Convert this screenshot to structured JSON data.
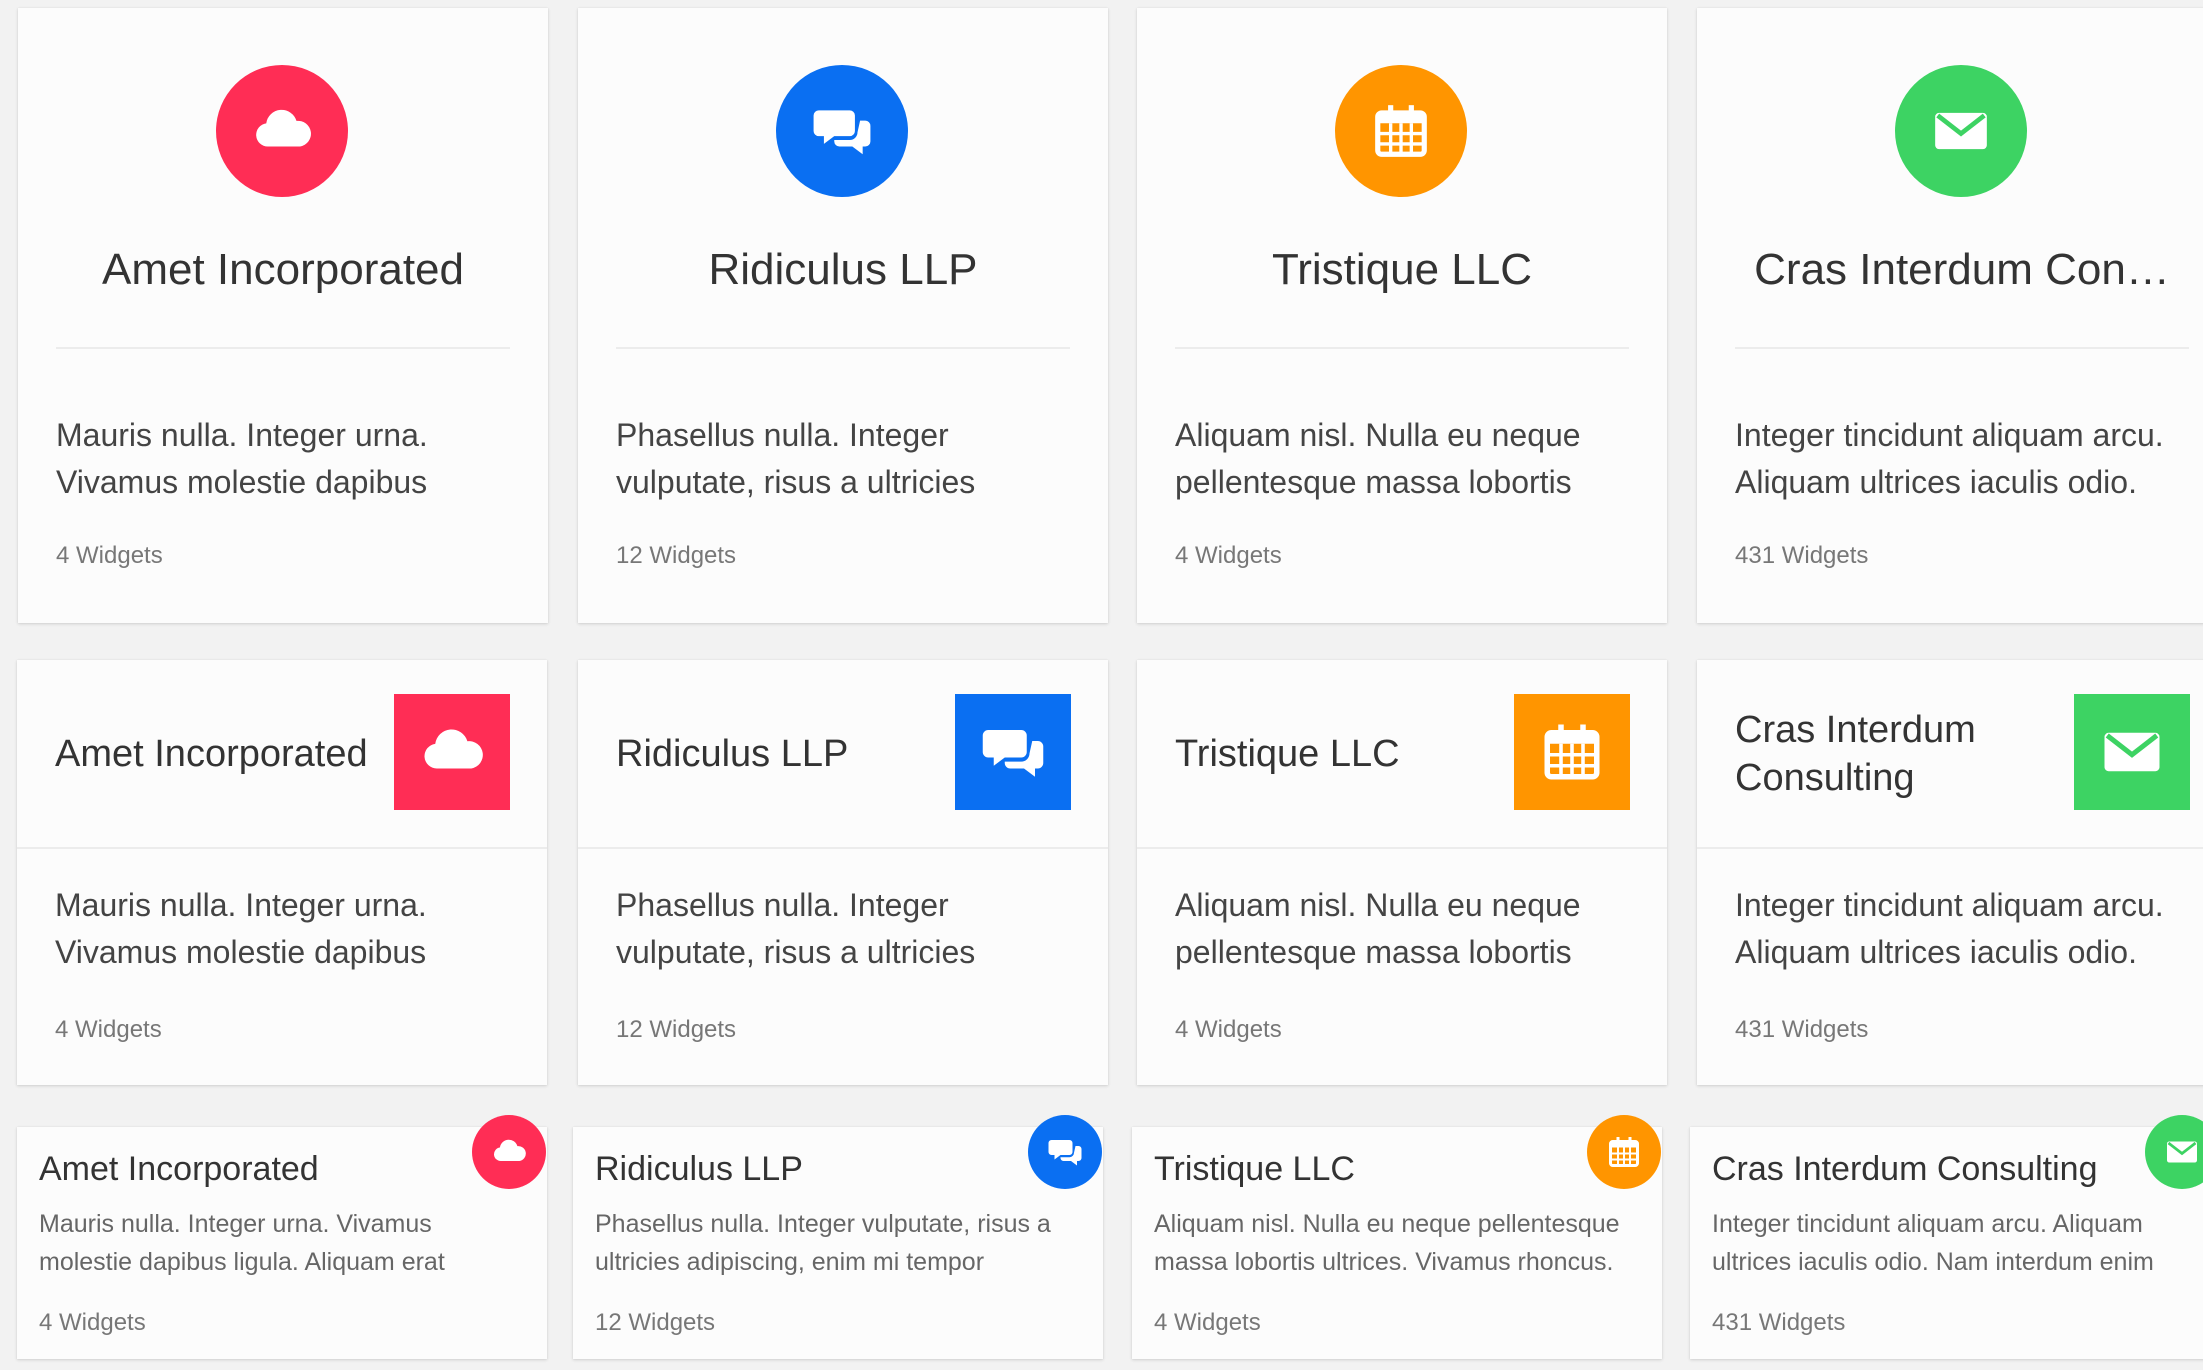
{
  "colors": {
    "red": "#ff2d55",
    "blue": "#0a6ff2",
    "orange": "#ff9500",
    "green": "#3dd363"
  },
  "companies": [
    {
      "name": "Amet Incorporated",
      "name_truncated": "Amet Incorporated",
      "name_wrapped": "Amet Incorporated",
      "icon": "cloud-icon",
      "desc_full": "Mauris nulla. Integer urna. Vivamus molestie dapibus",
      "desc_compact": "Mauris nulla. Integer urna. Vivamus molestie dapibus ligula. Aliquam erat",
      "widgets": "4 Widgets"
    },
    {
      "name": "Ridiculus LLP",
      "name_truncated": "Ridiculus LLP",
      "name_wrapped": "Ridiculus LLP",
      "icon": "chat-bubbles-icon",
      "desc_full": "Phasellus nulla. Integer vulputate, risus a ultricies",
      "desc_compact": "Phasellus nulla. Integer vulputate, risus a ultricies adipiscing, enim mi tempor",
      "widgets": "12 Widgets"
    },
    {
      "name": "Tristique LLC",
      "name_truncated": "Tristique LLC",
      "name_wrapped": "Tristique LLC",
      "icon": "calendar-icon",
      "desc_full": "Aliquam nisl. Nulla eu neque pellentesque massa lobortis",
      "desc_compact": "Aliquam nisl. Nulla eu neque pellentesque massa lobortis ultrices. Vivamus rhoncus.",
      "widgets": "4 Widgets"
    },
    {
      "name": "Cras Interdum Consulting",
      "name_truncated": "Cras Interdum Con…",
      "name_wrapped": "Cras Interdum Consulting",
      "icon": "envelope-icon",
      "desc_full": "Integer tincidunt aliquam arcu. Aliquam ultrices iaculis odio.",
      "desc_compact": "Integer tincidunt aliquam arcu. Aliquam ultrices iaculis odio. Nam interdum enim",
      "widgets": "431 Widgets"
    }
  ]
}
